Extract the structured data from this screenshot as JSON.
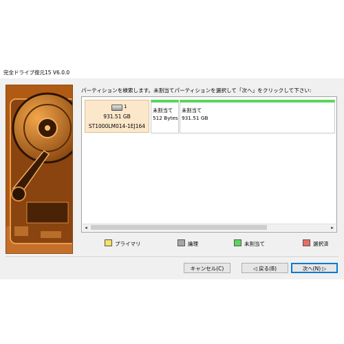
{
  "window": {
    "title": "完全ドライブ復元15 V6.0.0"
  },
  "instruction": "パーティションを検索します。未割当てパーティションを選択して「次へ」をクリックして下さい:",
  "disk": {
    "number": "1",
    "size": "931.51 GB",
    "model": "ST1000LM014-1EJ164"
  },
  "partitions": [
    {
      "label": "未割当て",
      "size": "512 Bytes"
    },
    {
      "label": "未割当て",
      "size": "931.51 GB"
    }
  ],
  "scrollbar": {
    "left_arrow": "◂",
    "right_arrow": "▸"
  },
  "legend": [
    {
      "label": "プライマリ",
      "color": "#f5e06a"
    },
    {
      "label": "論理",
      "color": "#a6a6a6"
    },
    {
      "label": "未割当て",
      "color": "#5ad65a"
    },
    {
      "label": "選択済",
      "color": "#e57060"
    }
  ],
  "buttons": {
    "cancel": "キャンセル(C)",
    "back": "◁ 戻る(B)",
    "next": "次へ(N) ▷"
  }
}
